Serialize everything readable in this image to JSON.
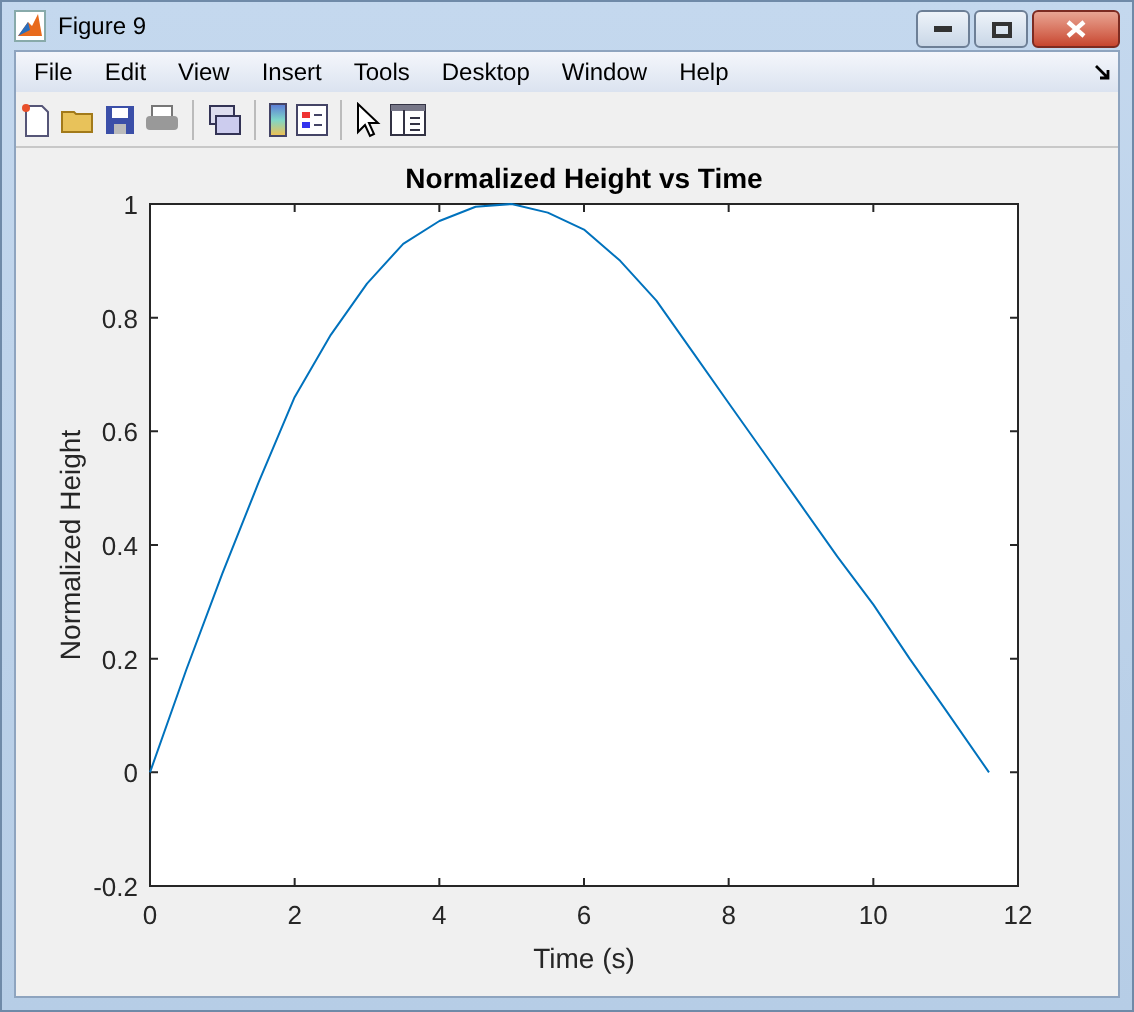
{
  "window": {
    "title": "Figure 9"
  },
  "menu_bar": [
    "File",
    "Edit",
    "View",
    "Insert",
    "Tools",
    "Desktop",
    "Window",
    "Help"
  ],
  "axes": {
    "chart_data": {
      "type": "line",
      "title": "Normalized Height vs Time",
      "xlabel": "Time (s)",
      "ylabel": "Normalized Height",
      "xlim": [
        0,
        12
      ],
      "ylim": [
        -0.2,
        1
      ],
      "xticks": [
        0,
        2,
        4,
        6,
        8,
        10,
        12
      ],
      "yticks": [
        -0.2,
        0,
        0.2,
        0.4,
        0.6,
        0.8,
        1
      ],
      "series": [
        {
          "color": "#0072bd",
          "x": [
            0,
            0.5,
            1,
            1.5,
            2,
            2.5,
            3,
            3.5,
            4,
            4.5,
            5,
            5.5,
            6,
            6.5,
            7,
            7.5,
            8,
            8.5,
            9,
            9.5,
            10,
            10.5,
            11,
            11.6
          ],
          "values": [
            0,
            0.18,
            0.35,
            0.51,
            0.66,
            0.77,
            0.86,
            0.93,
            0.97,
            0.995,
            1,
            0.985,
            0.955,
            0.9,
            0.83,
            0.74,
            0.65,
            0.56,
            0.47,
            0.38,
            0.295,
            0.2,
            0.11,
            0
          ]
        }
      ]
    }
  }
}
